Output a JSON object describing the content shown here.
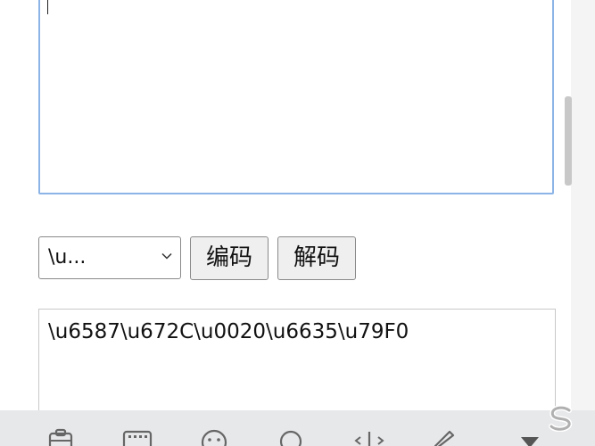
{
  "input": {
    "value": ""
  },
  "controls": {
    "encoding_select": {
      "selected": "\\u..."
    },
    "encode_label": "编码",
    "decode_label": "解码"
  },
  "output": {
    "value": "\\u6587\\u672C\\u0020\\u6635\\u79F0"
  },
  "keyboard_toolbar": {
    "icons": [
      "clipboard-icon",
      "keyboard-grid-icon",
      "emoji-icon",
      "search-icon",
      "cursor-move-icon",
      "pencil-icon",
      "collapse-down-icon",
      "sogou-logo-icon"
    ],
    "background": "#e7e8ea"
  },
  "colors": {
    "input_border": "#8cb4e6",
    "button_bg": "#efefef"
  }
}
